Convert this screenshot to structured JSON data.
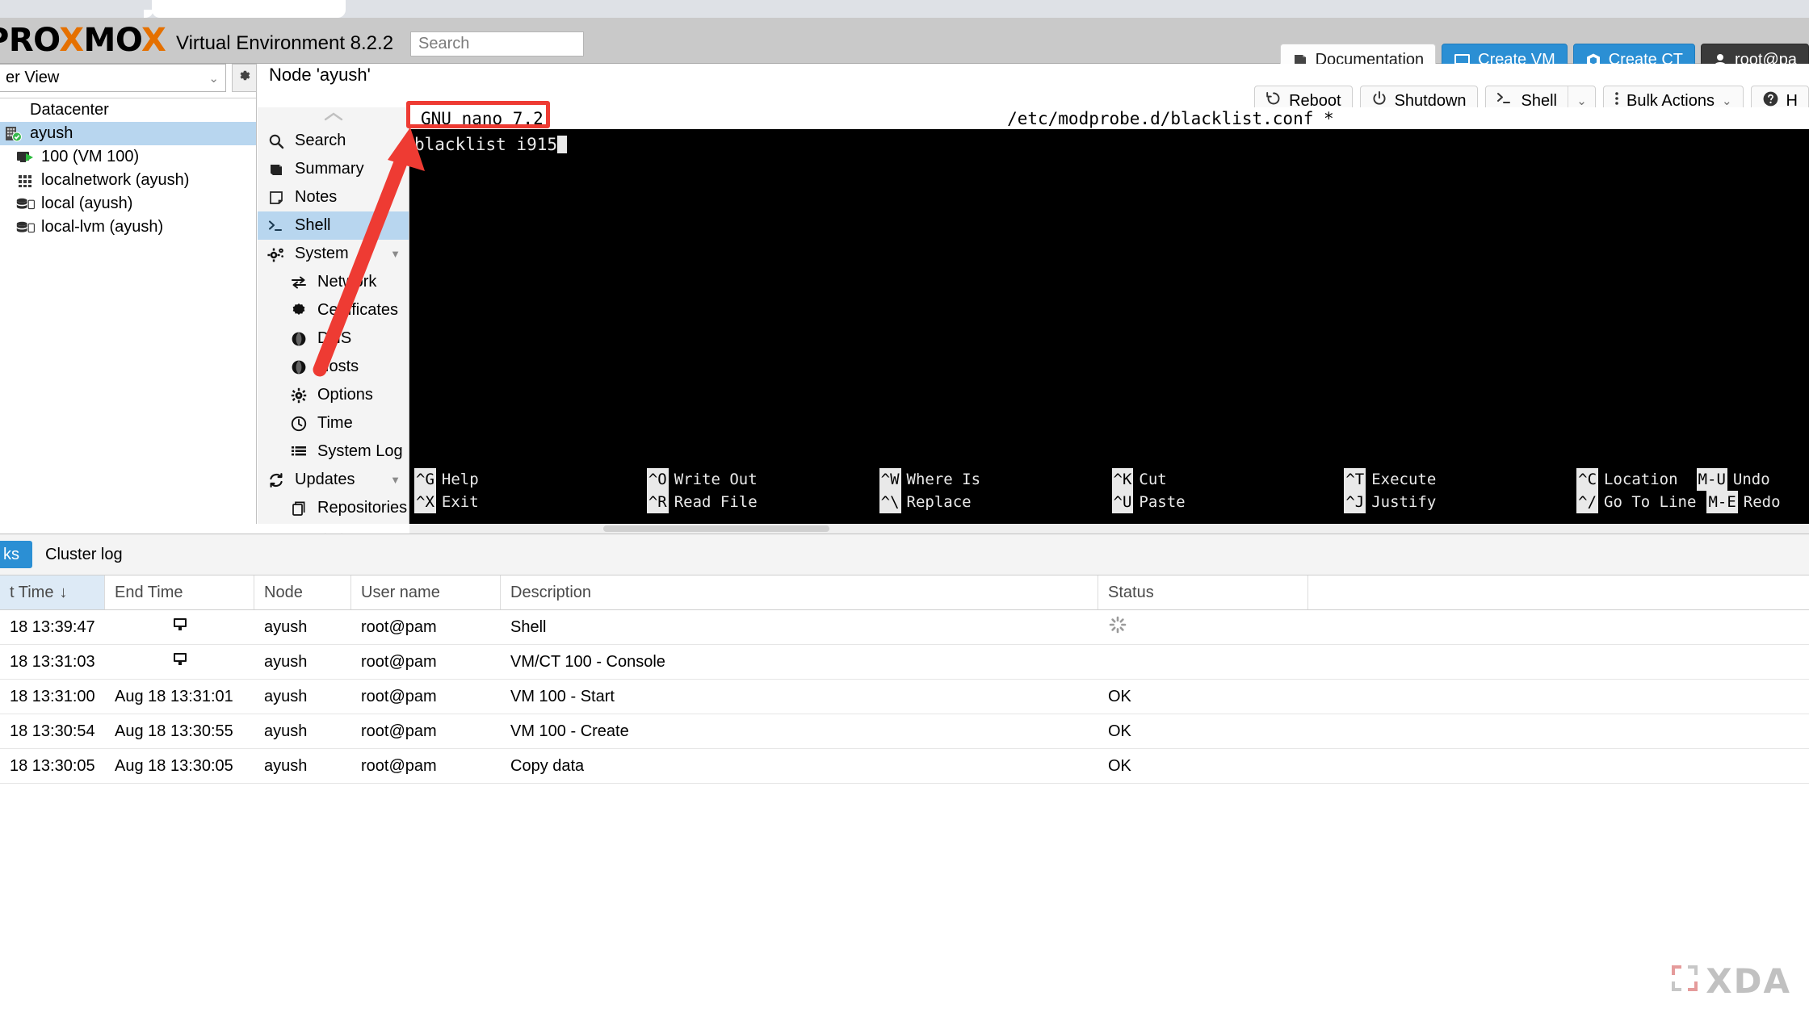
{
  "browser": {
    "tab_title": ""
  },
  "header": {
    "logo_text": "PROXMOX",
    "product": "Virtual Environment 8.2.2",
    "search_placeholder": "Search",
    "search_value": "",
    "documentation_label": "Documentation",
    "create_vm_label": "Create VM",
    "create_ct_label": "Create CT",
    "user_label": "root@pa",
    "accent_blue": "#2b8fd4",
    "logo_orange": "#e57000"
  },
  "resource_tree": {
    "view_label": "er View",
    "root_label": "Datacenter",
    "items": [
      {
        "label": "ayush",
        "icon": "server-icon",
        "selected": true,
        "level": 0
      },
      {
        "label": "100 (VM 100)",
        "icon": "vm-running-icon",
        "selected": false,
        "level": 1
      },
      {
        "label": "localnetwork (ayush)",
        "icon": "network-icon",
        "selected": false,
        "level": 1
      },
      {
        "label": "local (ayush)",
        "icon": "storage-icon",
        "selected": false,
        "level": 1
      },
      {
        "label": "local-lvm (ayush)",
        "icon": "storage-icon",
        "selected": false,
        "level": 1
      }
    ]
  },
  "node_panel": {
    "title": "Node 'ayush'",
    "toolbar": {
      "reboot_label": "Reboot",
      "shutdown_label": "Shutdown",
      "shell_label": "Shell",
      "bulk_actions_label": "Bulk Actions",
      "help_label": "H"
    },
    "menu": [
      {
        "label": "Search",
        "icon": "search-icon",
        "selected": false,
        "sub": false
      },
      {
        "label": "Summary",
        "icon": "book-icon",
        "selected": false,
        "sub": false
      },
      {
        "label": "Notes",
        "icon": "note-icon",
        "selected": false,
        "sub": false
      },
      {
        "label": "Shell",
        "icon": "terminal-icon",
        "selected": true,
        "sub": false
      },
      {
        "label": "System",
        "icon": "gears-icon",
        "selected": false,
        "sub": false,
        "expandable": true
      },
      {
        "label": "Network",
        "icon": "exchange-icon",
        "selected": false,
        "sub": true
      },
      {
        "label": "Certificates",
        "icon": "certificate-icon",
        "selected": false,
        "sub": true
      },
      {
        "label": "DNS",
        "icon": "globe-icon",
        "selected": false,
        "sub": true
      },
      {
        "label": "Hosts",
        "icon": "globe-icon",
        "selected": false,
        "sub": true
      },
      {
        "label": "Options",
        "icon": "gear-icon",
        "selected": false,
        "sub": true
      },
      {
        "label": "Time",
        "icon": "clock-icon",
        "selected": false,
        "sub": true
      },
      {
        "label": "System Log",
        "icon": "list-icon",
        "selected": false,
        "sub": true
      },
      {
        "label": "Updates",
        "icon": "refresh-icon",
        "selected": false,
        "sub": false,
        "expandable": true
      },
      {
        "label": "Repositories",
        "icon": "repository-icon",
        "selected": false,
        "sub": true
      }
    ]
  },
  "terminal": {
    "editor_version": "GNU nano 7.2",
    "file_path": "/etc/modprobe.d/blacklist.conf *",
    "content_line": "blacklist i915",
    "highlight_color": "#ee3b33",
    "shortcuts": [
      {
        "key": "^G",
        "label": "Help"
      },
      {
        "key": "^O",
        "label": "Write Out"
      },
      {
        "key": "^W",
        "label": "Where Is"
      },
      {
        "key": "^K",
        "label": "Cut"
      },
      {
        "key": "^T",
        "label": "Execute"
      },
      {
        "key": "^C",
        "label": "Location"
      },
      {
        "key": "M-U",
        "label": "Undo"
      },
      {
        "key": "^X",
        "label": "Exit"
      },
      {
        "key": "^R",
        "label": "Read File"
      },
      {
        "key": "^\\",
        "label": "Replace"
      },
      {
        "key": "^U",
        "label": "Paste"
      },
      {
        "key": "^J",
        "label": "Justify"
      },
      {
        "key": "^/",
        "label": "Go To Line"
      },
      {
        "key": "M-E",
        "label": "Redo"
      }
    ]
  },
  "tasks_panel": {
    "tabs": [
      {
        "label": "ks",
        "active": true
      },
      {
        "label": "Cluster log",
        "active": false
      }
    ],
    "columns": [
      "t Time",
      "End Time",
      "Node",
      "User name",
      "Description",
      "Status"
    ],
    "sort_indicator": "↓",
    "rows": [
      {
        "start": "18 13:39:47",
        "end": "",
        "end_icon": "console-icon",
        "node": "ayush",
        "user": "root@pam",
        "description": "Shell",
        "status": "",
        "status_icon": "spinner-icon"
      },
      {
        "start": "18 13:31:03",
        "end": "",
        "end_icon": "console-icon",
        "node": "ayush",
        "user": "root@pam",
        "description": "VM/CT 100 - Console",
        "status": "",
        "status_icon": ""
      },
      {
        "start": "18 13:31:00",
        "end": "Aug 18 13:31:01",
        "end_icon": "",
        "node": "ayush",
        "user": "root@pam",
        "description": "VM 100 - Start",
        "status": "OK",
        "status_icon": ""
      },
      {
        "start": "18 13:30:54",
        "end": "Aug 18 13:30:55",
        "end_icon": "",
        "node": "ayush",
        "user": "root@pam",
        "description": "VM 100 - Create",
        "status": "OK",
        "status_icon": ""
      },
      {
        "start": "18 13:30:05",
        "end": "Aug 18 13:30:05",
        "end_icon": "",
        "node": "ayush",
        "user": "root@pam",
        "description": "Copy data",
        "status": "OK",
        "status_icon": ""
      }
    ]
  },
  "watermark": {
    "text": "XDA"
  }
}
